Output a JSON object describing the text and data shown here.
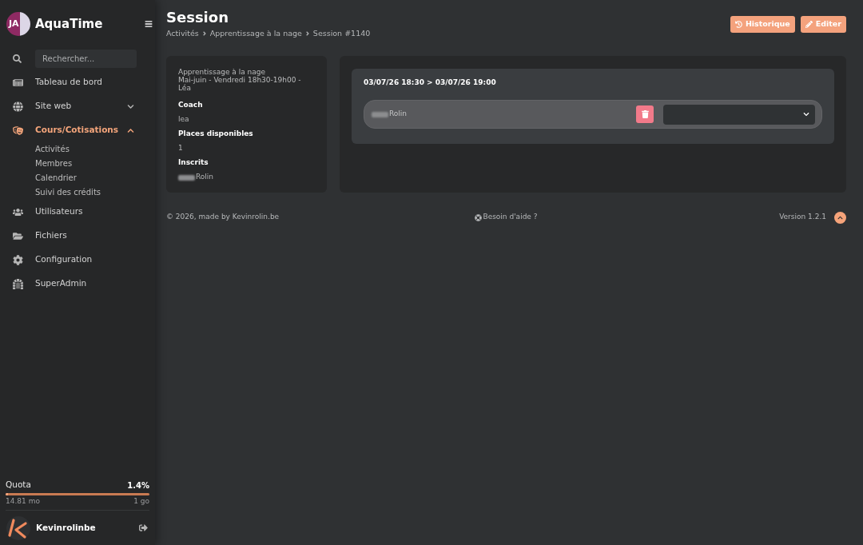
{
  "sidebar": {
    "logo_text": "JA",
    "brand": "AquaTime",
    "search": {
      "placeholder": "Rechercher..."
    },
    "items": [
      {
        "kind": "link",
        "label": "Tableau de bord",
        "selected": false
      },
      {
        "kind": "group",
        "label": "Site web",
        "selected": false,
        "expanded": false
      },
      {
        "kind": "group",
        "label": "Cours/Cotisations",
        "selected": true,
        "expanded": true,
        "children": [
          {
            "label": "Activités",
            "selected": false
          },
          {
            "label": "Membres",
            "selected": false
          },
          {
            "label": "Calendrier",
            "selected": false
          },
          {
            "label": "Suivi des crédits",
            "selected": false
          }
        ]
      },
      {
        "kind": "link",
        "label": "Utilisateurs",
        "selected": false
      },
      {
        "kind": "link",
        "label": "Fichiers",
        "selected": false
      },
      {
        "kind": "link",
        "label": "Configuration",
        "selected": false
      },
      {
        "kind": "link",
        "label": "SuperAdmin",
        "selected": false
      }
    ],
    "quota": {
      "label": "Quota",
      "value": "1.4%",
      "level": 0.014,
      "used": "14.81 mo",
      "total": "1 go"
    },
    "user": {
      "name": "Kevinrolinbe"
    }
  },
  "header": {
    "title": "Session",
    "breadcrumb": [
      "Activités",
      "Apprentissage à la nage",
      "Session #1140"
    ],
    "actions": [
      {
        "label": "Historique"
      },
      {
        "label": "Editer"
      }
    ]
  },
  "summary": {
    "activity": "Apprentissage à la nage",
    "schedule": "Mai-juin - Vendredi 18h30-19h00 - Léa",
    "fields": [
      {
        "label": "Coach",
        "value": "lea",
        "blurred_prefix": false
      },
      {
        "label": "Places disponibles",
        "value": "1",
        "blurred_prefix": false
      },
      {
        "label": "Inscrits",
        "value": "Rolin",
        "blurred_prefix": true
      }
    ]
  },
  "session": {
    "range": "03/07/26 18:30 > 03/07/26 19:00",
    "participants": [
      {
        "name": "Rolin",
        "blurred_prefix": true
      }
    ]
  },
  "footer": {
    "copyright": "© 2026, made by Kevinrolin.be",
    "help": "Besoin d'aide ?",
    "version": "Version 1.2.1"
  }
}
